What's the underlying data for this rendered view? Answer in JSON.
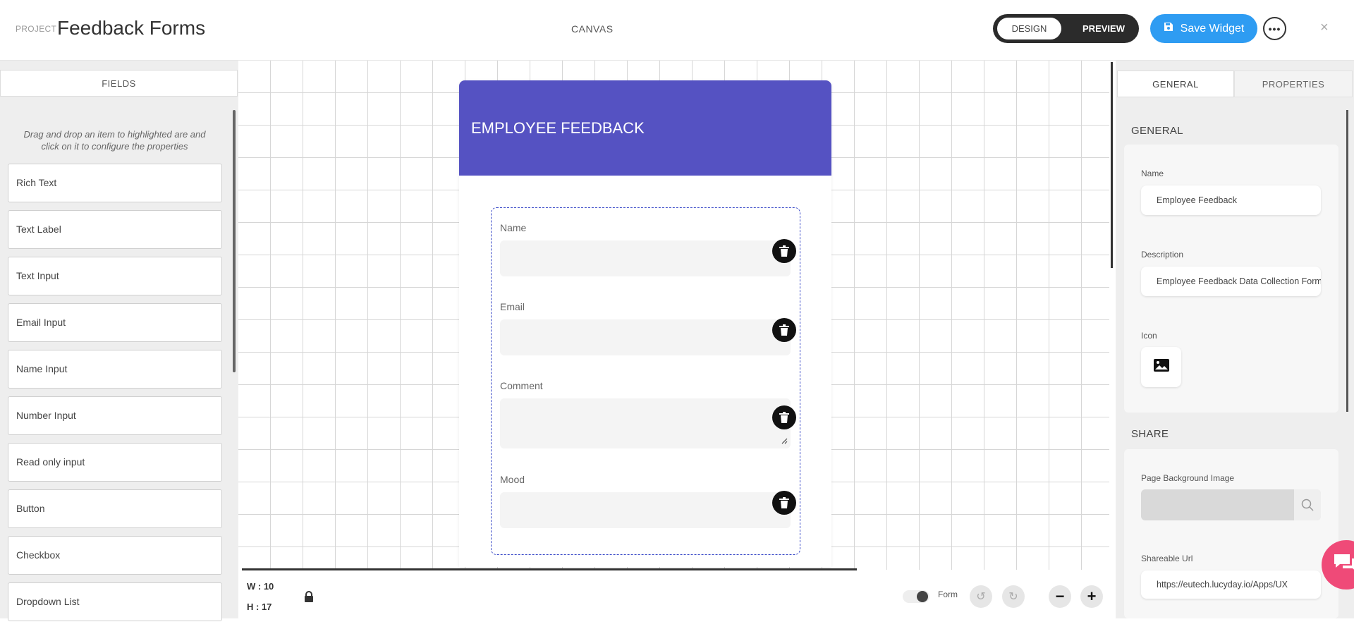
{
  "header": {
    "project_label": "PROJECT",
    "project_title": "Feedback Forms",
    "canvas_label": "CANVAS",
    "mode_toggle": {
      "design": "DESIGN",
      "preview": "PREVIEW",
      "active": "DESIGN"
    },
    "save_label": "Save Widget",
    "more_label": "•••",
    "close_label": "×"
  },
  "left_panel": {
    "tab": "FIELDS",
    "help_text": "Drag and drop an item to highlighted are and click on it to configure the properties",
    "fields": [
      "Rich Text",
      "Text Label",
      "Text Input",
      "Email Input",
      "Name Input",
      "Number Input",
      "Read only input",
      "Button",
      "Checkbox",
      "Dropdown List"
    ]
  },
  "canvas": {
    "form_title": "EMPLOYEE FEEDBACK",
    "form_fields": [
      {
        "label": "Name"
      },
      {
        "label": "Email"
      },
      {
        "label": "Comment"
      },
      {
        "label": "Mood"
      }
    ],
    "header_color": "#5552c2"
  },
  "bottom_bar": {
    "width": "W : 10",
    "height": "H : 17",
    "mode_label": "Form",
    "undo": "↺",
    "redo": "↻",
    "zoom_out": "−",
    "zoom_in": "+"
  },
  "right_panel": {
    "tabs": [
      "GENERAL",
      "PROPERTIES"
    ],
    "active_tab": "GENERAL",
    "general": {
      "section": "GENERAL",
      "name_label": "Name",
      "name_value": "Employee Feedback",
      "description_label": "Description",
      "description_value": "Employee Feedback Data Collection Form",
      "icon_label": "Icon"
    },
    "share": {
      "section": "SHARE",
      "bg_image_label": "Page Background Image",
      "url_label": "Shareable Url",
      "url_value": "https://eutech.lucyday.io/Apps/UX"
    }
  },
  "colors": {
    "accent": "#2e9cf2",
    "form_header": "#5552c2",
    "chat": "#ef4a78"
  },
  "icons": [
    "save-icon",
    "trash-icon",
    "lock-icon",
    "image-icon",
    "search-icon",
    "chat-icon",
    "undo-icon",
    "redo-icon"
  ]
}
